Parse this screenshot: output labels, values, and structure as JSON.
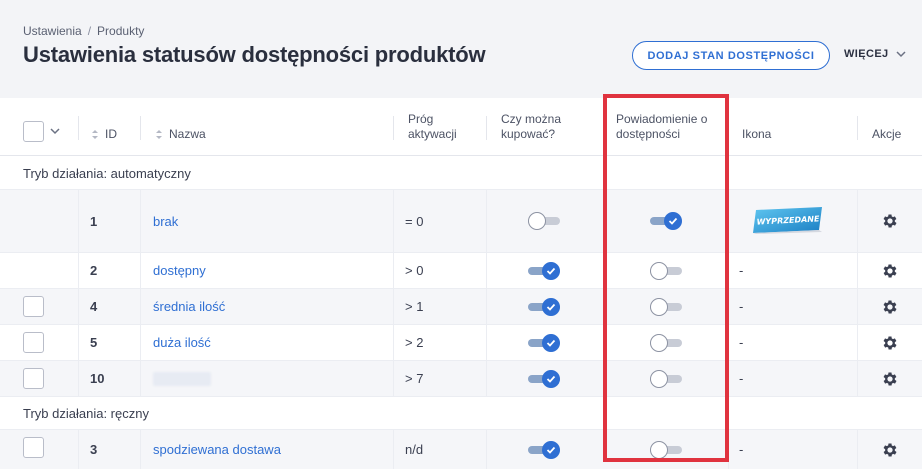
{
  "breadcrumb": {
    "root": "Ustawienia",
    "separator": "/",
    "current": "Produkty"
  },
  "page": {
    "title": "Ustawienia statusów dostępności produktów"
  },
  "actions": {
    "add_label": "DODAJ STAN DOSTĘPNOŚCI",
    "more_label": "WIĘCEJ"
  },
  "columns": {
    "id": "ID",
    "name": "Nazwa",
    "threshold_1": "Próg",
    "threshold_2": "aktywacji",
    "can_buy_1": "Czy można",
    "can_buy_2": "kupować?",
    "notify_1": "Powiadomienie o",
    "notify_2": "dostępności",
    "icon": "Ikona",
    "actions": "Akcje"
  },
  "groups": [
    {
      "label": "Tryb działania: automatyczny"
    },
    {
      "label": "Tryb działania: ręczny"
    }
  ],
  "rows": [
    {
      "id": "1",
      "name": "brak",
      "threshold": "= 0",
      "can_buy": false,
      "notify": true,
      "icon": "WYPRZEDANE",
      "has_checkbox": false
    },
    {
      "id": "2",
      "name": "dostępny",
      "threshold": "> 0",
      "can_buy": true,
      "notify": false,
      "icon": "-",
      "has_checkbox": false
    },
    {
      "id": "4",
      "name": "średnia ilość",
      "threshold": "> 1",
      "can_buy": true,
      "notify": false,
      "icon": "-",
      "has_checkbox": true
    },
    {
      "id": "5",
      "name": "duża ilość",
      "threshold": "> 2",
      "can_buy": true,
      "notify": false,
      "icon": "-",
      "has_checkbox": true
    },
    {
      "id": "10",
      "name": "",
      "threshold": "> 7",
      "can_buy": true,
      "notify": false,
      "icon": "-",
      "has_checkbox": true
    },
    {
      "id": "3",
      "name": "spodziewana dostawa",
      "threshold": "n/d",
      "can_buy": true,
      "notify": false,
      "icon": "-",
      "has_checkbox": true
    }
  ],
  "colors": {
    "accent": "#2f6fd3",
    "highlight": "#e0333f"
  }
}
